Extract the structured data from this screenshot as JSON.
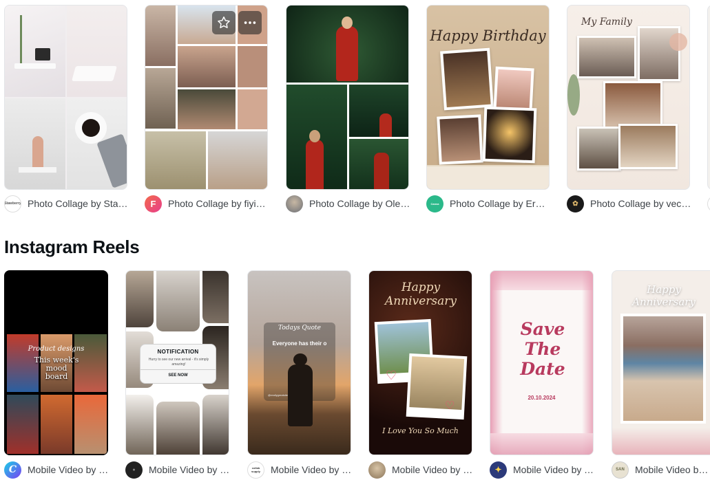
{
  "photo_collages": [
    {
      "label": "Photo Collage by Staw…",
      "avatar_text": "Stawberry",
      "avatar_bg": "#ffffff"
    },
    {
      "label": "Photo Collage by fiyixi…",
      "avatar_text": "F",
      "avatar_bg": "#f0466e"
    },
    {
      "label": "Photo Collage by Oleg…",
      "avatar_text": "",
      "avatar_bg": "#8a8f96"
    },
    {
      "label": "Photo Collage by Erm…",
      "avatar_text": "Canva",
      "avatar_bg": "#2bb98a"
    },
    {
      "label": "Photo Collage by vect…",
      "avatar_text": "✿",
      "avatar_bg": "#1a1a1a"
    }
  ],
  "collage_texts": {
    "birthday_title": "Happy Birthday",
    "family_title": "My Family"
  },
  "section": {
    "title": "Instagram Reels"
  },
  "reels": [
    {
      "label": "Mobile Video by …",
      "avatar_text": "C",
      "avatar_bg": "#5a3ff0"
    },
    {
      "label": "Mobile Video by …",
      "avatar_text": "●",
      "avatar_bg": "#222222"
    },
    {
      "label": "Mobile Video by …",
      "avatar_text": "collab supply",
      "avatar_bg": "#ffffff"
    },
    {
      "label": "Mobile Video by s…",
      "avatar_text": "",
      "avatar_bg": "#b59b7a"
    },
    {
      "label": "Mobile Video by T…",
      "avatar_text": "✦",
      "avatar_bg": "#2c3a7a"
    },
    {
      "label": "Mobile Video by S",
      "avatar_text": "SAN",
      "avatar_bg": "#e8e2d2"
    }
  ],
  "reel_texts": {
    "mood_script": "Product designs",
    "mood_board": "This week's mood board",
    "notification_title": "NOTIFICATION",
    "notification_body": "Hurry to see our new arrival - it's simply amazing!",
    "notification_button": "SEE NOW",
    "quote_script": "Todays Quote",
    "quote_text": "Everyone has their o",
    "quote_handle": "@reallygreatsite",
    "anniv_title": "Happy Anniversary",
    "anniv_footer": "I Love You So Much",
    "save_date_title": "Save The Date",
    "save_date_date": "20.10.2024",
    "anniv2_title": "Happy Anniversary"
  },
  "icons": {
    "favorite": "star-outline-icon",
    "more": "more-dots-icon"
  }
}
